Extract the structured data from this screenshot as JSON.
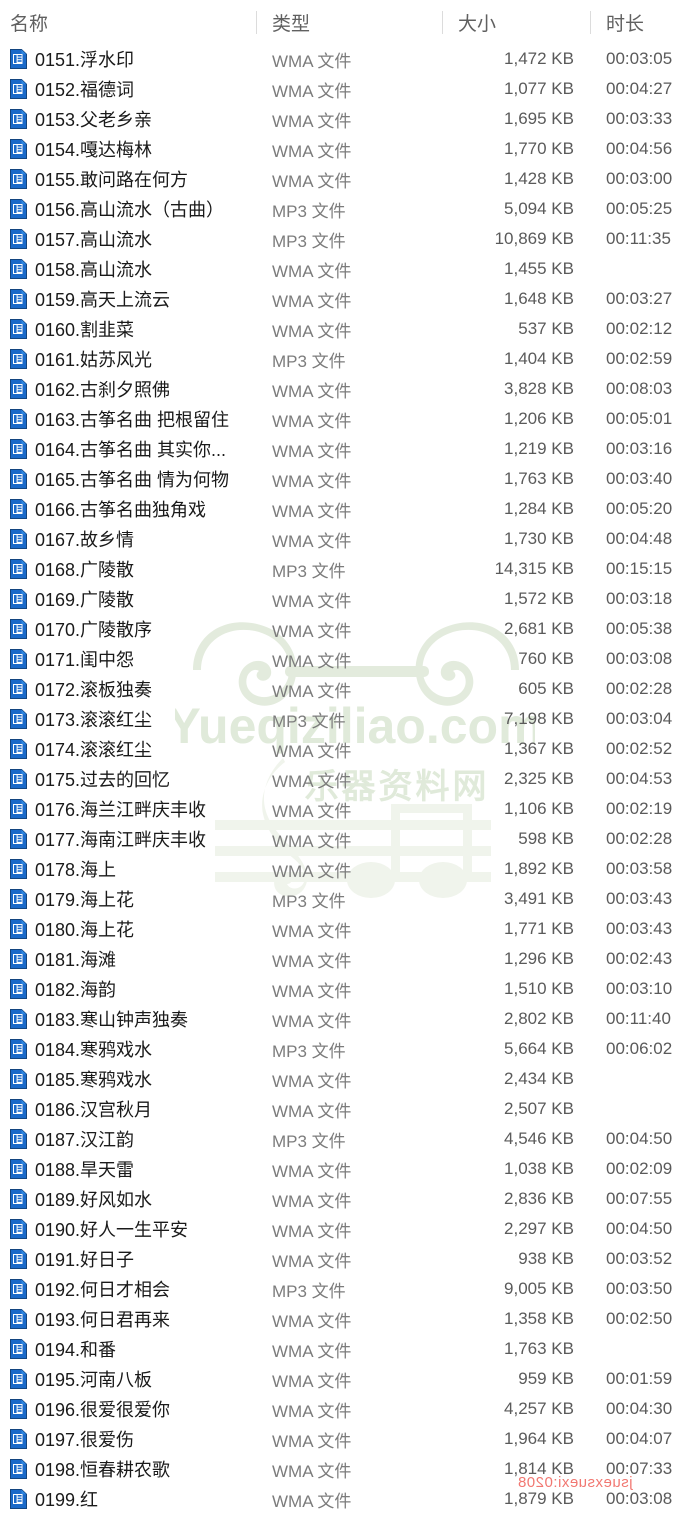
{
  "window": {
    "view": "details-list",
    "accent_color": "#1b6ac9",
    "icon_name": "media-file-icon"
  },
  "columns": {
    "name": "名称",
    "type": "类型",
    "size": "大小",
    "duration": "时长"
  },
  "watermark": {
    "brand_text": "Yueqiziliao.com",
    "brand_subtext": "乐器资料网",
    "color": "#e2ebdd",
    "red_overlay_text": "jsuexsuexi:0208"
  },
  "files": [
    {
      "name": "0151.浮水印",
      "type": "WMA 文件",
      "size": "1,472 KB",
      "duration": "00:03:05"
    },
    {
      "name": "0152.福德词",
      "type": "WMA 文件",
      "size": "1,077 KB",
      "duration": "00:04:27"
    },
    {
      "name": "0153.父老乡亲",
      "type": "WMA 文件",
      "size": "1,695 KB",
      "duration": "00:03:33"
    },
    {
      "name": "0154.嘎达梅林",
      "type": "WMA 文件",
      "size": "1,770 KB",
      "duration": "00:04:56"
    },
    {
      "name": "0155.敢问路在何方",
      "type": "WMA 文件",
      "size": "1,428 KB",
      "duration": "00:03:00"
    },
    {
      "name": "0156.高山流水（古曲）",
      "type": "MP3 文件",
      "size": "5,094 KB",
      "duration": "00:05:25"
    },
    {
      "name": "0157.高山流水",
      "type": "MP3 文件",
      "size": "10,869 KB",
      "duration": "00:11:35"
    },
    {
      "name": "0158.高山流水",
      "type": "WMA 文件",
      "size": "1,455 KB",
      "duration": ""
    },
    {
      "name": "0159.高天上流云",
      "type": "WMA 文件",
      "size": "1,648 KB",
      "duration": "00:03:27"
    },
    {
      "name": "0160.割韭菜",
      "type": "WMA 文件",
      "size": "537 KB",
      "duration": "00:02:12"
    },
    {
      "name": "0161.姑苏风光",
      "type": "MP3 文件",
      "size": "1,404 KB",
      "duration": "00:02:59"
    },
    {
      "name": "0162.古刹夕照佛",
      "type": "WMA 文件",
      "size": "3,828 KB",
      "duration": "00:08:03"
    },
    {
      "name": "0163.古筝名曲 把根留住",
      "type": "WMA 文件",
      "size": "1,206 KB",
      "duration": "00:05:01"
    },
    {
      "name": "0164.古筝名曲 其实你...",
      "type": "WMA 文件",
      "size": "1,219 KB",
      "duration": "00:03:16"
    },
    {
      "name": "0165.古筝名曲 情为何物",
      "type": "WMA 文件",
      "size": "1,763 KB",
      "duration": "00:03:40"
    },
    {
      "name": "0166.古筝名曲独角戏",
      "type": "WMA 文件",
      "size": "1,284 KB",
      "duration": "00:05:20"
    },
    {
      "name": "0167.故乡情",
      "type": "WMA 文件",
      "size": "1,730 KB",
      "duration": "00:04:48"
    },
    {
      "name": "0168.广陵散",
      "type": "MP3 文件",
      "size": "14,315 KB",
      "duration": "00:15:15"
    },
    {
      "name": "0169.广陵散",
      "type": "WMA 文件",
      "size": "1,572 KB",
      "duration": "00:03:18"
    },
    {
      "name": "0170.广陵散序",
      "type": "WMA 文件",
      "size": "2,681 KB",
      "duration": "00:05:38"
    },
    {
      "name": "0171.闺中怨",
      "type": "WMA 文件",
      "size": "760 KB",
      "duration": "00:03:08"
    },
    {
      "name": "0172.滚板独奏",
      "type": "WMA 文件",
      "size": "605 KB",
      "duration": "00:02:28"
    },
    {
      "name": "0173.滚滚红尘",
      "type": "MP3 文件",
      "size": "7,198 KB",
      "duration": "00:03:04"
    },
    {
      "name": "0174.滚滚红尘",
      "type": "WMA 文件",
      "size": "1,367 KB",
      "duration": "00:02:52"
    },
    {
      "name": "0175.过去的回忆",
      "type": "WMA 文件",
      "size": "2,325 KB",
      "duration": "00:04:53"
    },
    {
      "name": "0176.海兰江畔庆丰收",
      "type": "WMA 文件",
      "size": "1,106 KB",
      "duration": "00:02:19"
    },
    {
      "name": "0177.海南江畔庆丰收",
      "type": "WMA 文件",
      "size": "598 KB",
      "duration": "00:02:28"
    },
    {
      "name": "0178.海上",
      "type": "WMA 文件",
      "size": "1,892 KB",
      "duration": "00:03:58"
    },
    {
      "name": "0179.海上花",
      "type": "MP3 文件",
      "size": "3,491 KB",
      "duration": "00:03:43"
    },
    {
      "name": "0180.海上花",
      "type": "WMA 文件",
      "size": "1,771 KB",
      "duration": "00:03:43"
    },
    {
      "name": "0181.海滩",
      "type": "WMA 文件",
      "size": "1,296 KB",
      "duration": "00:02:43"
    },
    {
      "name": "0182.海韵",
      "type": "WMA 文件",
      "size": "1,510 KB",
      "duration": "00:03:10"
    },
    {
      "name": "0183.寒山钟声独奏",
      "type": "WMA 文件",
      "size": "2,802 KB",
      "duration": "00:11:40"
    },
    {
      "name": "0184.寒鸦戏水",
      "type": "MP3 文件",
      "size": "5,664 KB",
      "duration": "00:06:02"
    },
    {
      "name": "0185.寒鸦戏水",
      "type": "WMA 文件",
      "size": "2,434 KB",
      "duration": ""
    },
    {
      "name": "0186.汉宫秋月",
      "type": "WMA 文件",
      "size": "2,507 KB",
      "duration": ""
    },
    {
      "name": "0187.汉江韵",
      "type": "MP3 文件",
      "size": "4,546 KB",
      "duration": "00:04:50"
    },
    {
      "name": "0188.旱天雷",
      "type": "WMA 文件",
      "size": "1,038 KB",
      "duration": "00:02:09"
    },
    {
      "name": "0189.好风如水",
      "type": "WMA 文件",
      "size": "2,836 KB",
      "duration": "00:07:55"
    },
    {
      "name": "0190.好人一生平安",
      "type": "WMA 文件",
      "size": "2,297 KB",
      "duration": "00:04:50"
    },
    {
      "name": "0191.好日子",
      "type": "WMA 文件",
      "size": "938 KB",
      "duration": "00:03:52"
    },
    {
      "name": "0192.何日才相会",
      "type": "MP3 文件",
      "size": "9,005 KB",
      "duration": "00:03:50"
    },
    {
      "name": "0193.何日君再来",
      "type": "WMA 文件",
      "size": "1,358 KB",
      "duration": "00:02:50"
    },
    {
      "name": "0194.和番",
      "type": "WMA 文件",
      "size": "1,763 KB",
      "duration": ""
    },
    {
      "name": "0195.河南八板",
      "type": "WMA 文件",
      "size": "959 KB",
      "duration": "00:01:59"
    },
    {
      "name": "0196.很爱很爱你",
      "type": "WMA 文件",
      "size": "4,257 KB",
      "duration": "00:04:30"
    },
    {
      "name": "0197.很爱伤",
      "type": "WMA 文件",
      "size": "1,964 KB",
      "duration": "00:04:07"
    },
    {
      "name": "0198.恒春耕农歌",
      "type": "WMA 文件",
      "size": "1,814 KB",
      "duration": "00:07:33"
    },
    {
      "name": "0199.红",
      "type": "WMA 文件",
      "size": "1,879 KB",
      "duration": "00:03:08"
    }
  ]
}
